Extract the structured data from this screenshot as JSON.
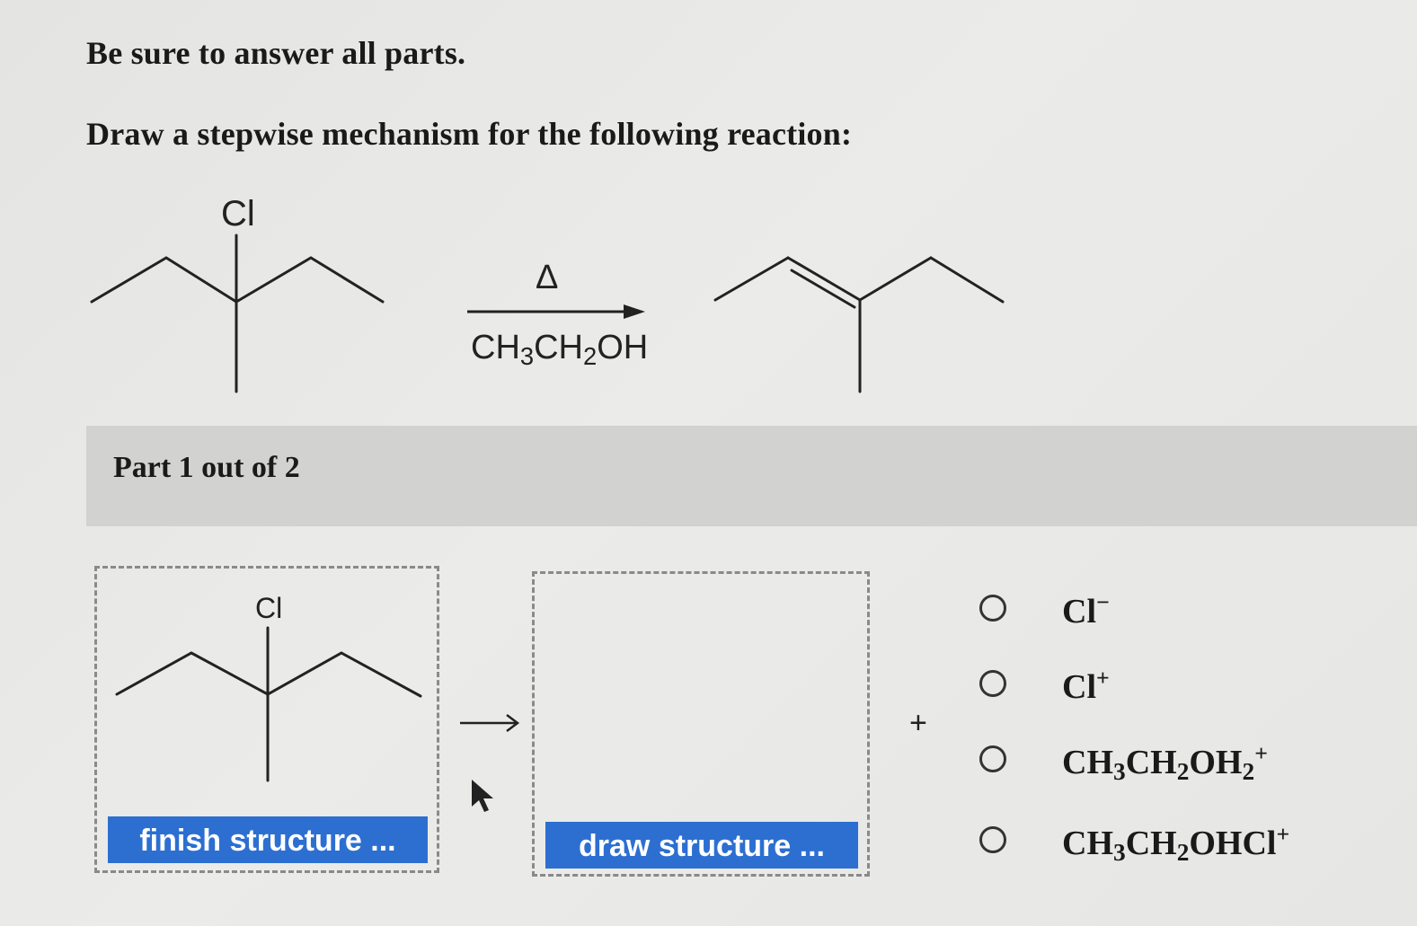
{
  "instructions": "Be sure to answer all parts.",
  "question": "Draw a stepwise mechanism for the following reaction:",
  "reaction": {
    "reactant_atom": "Cl",
    "condition_above": "Δ",
    "condition_below": {
      "p1": "CH",
      "s1": "3",
      "p2": "CH",
      "s2": "2",
      "p3": "OH"
    }
  },
  "part": {
    "label": "Part 1 out of 2",
    "reactant_atom": "Cl",
    "finish_button": "finish structure ...",
    "draw_button": "draw structure ...",
    "plus": "+",
    "options": [
      {
        "main": "Cl",
        "charge": "−"
      },
      {
        "main": "Cl",
        "charge": "+"
      },
      {
        "p1": "CH",
        "s1": "3",
        "p2": "CH",
        "s2": "2",
        "p3": "OH",
        "s3": "2",
        "charge": "+"
      },
      {
        "p1": "CH",
        "s1": "3",
        "p2": "CH",
        "s2": "2",
        "p3": "OHCl",
        "charge": "+"
      }
    ]
  }
}
